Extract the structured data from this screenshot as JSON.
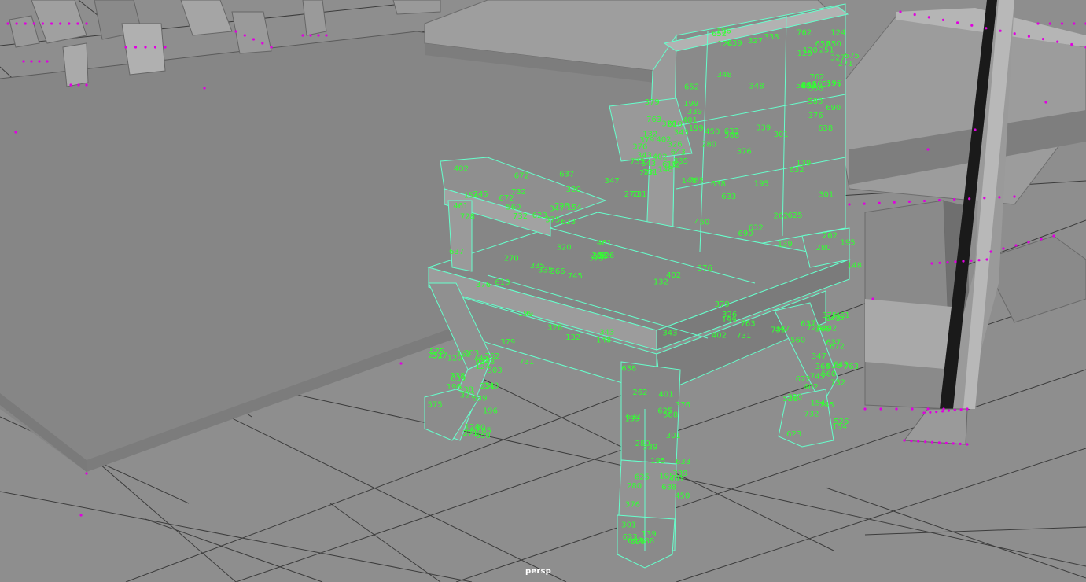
{
  "viewport": {
    "camera_name": "persp",
    "panel": "perspective-viewport"
  },
  "colors": {
    "background": "#8d8d8d",
    "grid_line": "#3c3c3c",
    "selected_wireframe": "#66ffcc",
    "vertex_id_text": "#33ff33",
    "vertex_dot": "#e000e0",
    "camera_label": "#ffffff"
  },
  "selected_object": {
    "display_mode": "shaded-with-wireframe",
    "vertex_numbers_visible": true,
    "sample_vertex_ids": [
      "652",
      "633",
      "623",
      "148",
      "639",
      "638",
      "637",
      "731",
      "762",
      "632",
      "526",
      "199",
      "196",
      "195",
      "154",
      "132",
      "251",
      "280",
      "732",
      "643",
      "120",
      "139",
      "745",
      "763",
      "124",
      "376",
      "366",
      "402",
      "338",
      "339",
      "672",
      "326",
      "327",
      "301",
      "375",
      "343",
      "348",
      "588",
      "347",
      "379",
      "565",
      "450",
      "461",
      "335",
      "303",
      "401",
      "402",
      "270",
      "271",
      "262",
      "320",
      "376",
      "575",
      "625",
      "560",
      "610",
      "650",
      "690",
      "728",
      "735"
    ]
  }
}
